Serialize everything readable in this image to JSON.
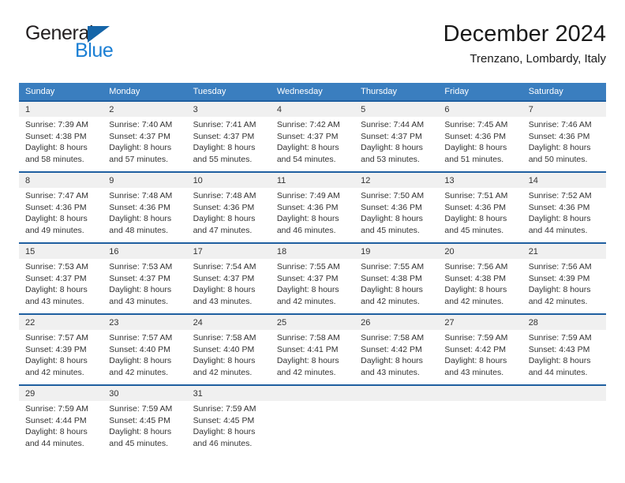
{
  "brand": {
    "name_part1": "General",
    "name_part2": "Blue",
    "triangle_color": "#1565a8",
    "blue_color": "#1b7fd4"
  },
  "header": {
    "title": "December 2024",
    "subtitle": "Trenzano, Lombardy, Italy"
  },
  "theme": {
    "header_row_bg": "#3a7ebf",
    "week_separator": "#1f5fa0",
    "daynum_bg": "#f0f0f0",
    "text": "#333333"
  },
  "calendar": {
    "weekday_headers": [
      "Sunday",
      "Monday",
      "Tuesday",
      "Wednesday",
      "Thursday",
      "Friday",
      "Saturday"
    ],
    "weeks": [
      {
        "days": [
          {
            "num": "1",
            "sunrise": "Sunrise: 7:39 AM",
            "sunset": "Sunset: 4:38 PM",
            "daylight1": "Daylight: 8 hours",
            "daylight2": "and 58 minutes."
          },
          {
            "num": "2",
            "sunrise": "Sunrise: 7:40 AM",
            "sunset": "Sunset: 4:37 PM",
            "daylight1": "Daylight: 8 hours",
            "daylight2": "and 57 minutes."
          },
          {
            "num": "3",
            "sunrise": "Sunrise: 7:41 AM",
            "sunset": "Sunset: 4:37 PM",
            "daylight1": "Daylight: 8 hours",
            "daylight2": "and 55 minutes."
          },
          {
            "num": "4",
            "sunrise": "Sunrise: 7:42 AM",
            "sunset": "Sunset: 4:37 PM",
            "daylight1": "Daylight: 8 hours",
            "daylight2": "and 54 minutes."
          },
          {
            "num": "5",
            "sunrise": "Sunrise: 7:44 AM",
            "sunset": "Sunset: 4:37 PM",
            "daylight1": "Daylight: 8 hours",
            "daylight2": "and 53 minutes."
          },
          {
            "num": "6",
            "sunrise": "Sunrise: 7:45 AM",
            "sunset": "Sunset: 4:36 PM",
            "daylight1": "Daylight: 8 hours",
            "daylight2": "and 51 minutes."
          },
          {
            "num": "7",
            "sunrise": "Sunrise: 7:46 AM",
            "sunset": "Sunset: 4:36 PM",
            "daylight1": "Daylight: 8 hours",
            "daylight2": "and 50 minutes."
          }
        ]
      },
      {
        "days": [
          {
            "num": "8",
            "sunrise": "Sunrise: 7:47 AM",
            "sunset": "Sunset: 4:36 PM",
            "daylight1": "Daylight: 8 hours",
            "daylight2": "and 49 minutes."
          },
          {
            "num": "9",
            "sunrise": "Sunrise: 7:48 AM",
            "sunset": "Sunset: 4:36 PM",
            "daylight1": "Daylight: 8 hours",
            "daylight2": "and 48 minutes."
          },
          {
            "num": "10",
            "sunrise": "Sunrise: 7:48 AM",
            "sunset": "Sunset: 4:36 PM",
            "daylight1": "Daylight: 8 hours",
            "daylight2": "and 47 minutes."
          },
          {
            "num": "11",
            "sunrise": "Sunrise: 7:49 AM",
            "sunset": "Sunset: 4:36 PM",
            "daylight1": "Daylight: 8 hours",
            "daylight2": "and 46 minutes."
          },
          {
            "num": "12",
            "sunrise": "Sunrise: 7:50 AM",
            "sunset": "Sunset: 4:36 PM",
            "daylight1": "Daylight: 8 hours",
            "daylight2": "and 45 minutes."
          },
          {
            "num": "13",
            "sunrise": "Sunrise: 7:51 AM",
            "sunset": "Sunset: 4:36 PM",
            "daylight1": "Daylight: 8 hours",
            "daylight2": "and 45 minutes."
          },
          {
            "num": "14",
            "sunrise": "Sunrise: 7:52 AM",
            "sunset": "Sunset: 4:36 PM",
            "daylight1": "Daylight: 8 hours",
            "daylight2": "and 44 minutes."
          }
        ]
      },
      {
        "days": [
          {
            "num": "15",
            "sunrise": "Sunrise: 7:53 AM",
            "sunset": "Sunset: 4:37 PM",
            "daylight1": "Daylight: 8 hours",
            "daylight2": "and 43 minutes."
          },
          {
            "num": "16",
            "sunrise": "Sunrise: 7:53 AM",
            "sunset": "Sunset: 4:37 PM",
            "daylight1": "Daylight: 8 hours",
            "daylight2": "and 43 minutes."
          },
          {
            "num": "17",
            "sunrise": "Sunrise: 7:54 AM",
            "sunset": "Sunset: 4:37 PM",
            "daylight1": "Daylight: 8 hours",
            "daylight2": "and 43 minutes."
          },
          {
            "num": "18",
            "sunrise": "Sunrise: 7:55 AM",
            "sunset": "Sunset: 4:37 PM",
            "daylight1": "Daylight: 8 hours",
            "daylight2": "and 42 minutes."
          },
          {
            "num": "19",
            "sunrise": "Sunrise: 7:55 AM",
            "sunset": "Sunset: 4:38 PM",
            "daylight1": "Daylight: 8 hours",
            "daylight2": "and 42 minutes."
          },
          {
            "num": "20",
            "sunrise": "Sunrise: 7:56 AM",
            "sunset": "Sunset: 4:38 PM",
            "daylight1": "Daylight: 8 hours",
            "daylight2": "and 42 minutes."
          },
          {
            "num": "21",
            "sunrise": "Sunrise: 7:56 AM",
            "sunset": "Sunset: 4:39 PM",
            "daylight1": "Daylight: 8 hours",
            "daylight2": "and 42 minutes."
          }
        ]
      },
      {
        "days": [
          {
            "num": "22",
            "sunrise": "Sunrise: 7:57 AM",
            "sunset": "Sunset: 4:39 PM",
            "daylight1": "Daylight: 8 hours",
            "daylight2": "and 42 minutes."
          },
          {
            "num": "23",
            "sunrise": "Sunrise: 7:57 AM",
            "sunset": "Sunset: 4:40 PM",
            "daylight1": "Daylight: 8 hours",
            "daylight2": "and 42 minutes."
          },
          {
            "num": "24",
            "sunrise": "Sunrise: 7:58 AM",
            "sunset": "Sunset: 4:40 PM",
            "daylight1": "Daylight: 8 hours",
            "daylight2": "and 42 minutes."
          },
          {
            "num": "25",
            "sunrise": "Sunrise: 7:58 AM",
            "sunset": "Sunset: 4:41 PM",
            "daylight1": "Daylight: 8 hours",
            "daylight2": "and 42 minutes."
          },
          {
            "num": "26",
            "sunrise": "Sunrise: 7:58 AM",
            "sunset": "Sunset: 4:42 PM",
            "daylight1": "Daylight: 8 hours",
            "daylight2": "and 43 minutes."
          },
          {
            "num": "27",
            "sunrise": "Sunrise: 7:59 AM",
            "sunset": "Sunset: 4:42 PM",
            "daylight1": "Daylight: 8 hours",
            "daylight2": "and 43 minutes."
          },
          {
            "num": "28",
            "sunrise": "Sunrise: 7:59 AM",
            "sunset": "Sunset: 4:43 PM",
            "daylight1": "Daylight: 8 hours",
            "daylight2": "and 44 minutes."
          }
        ]
      },
      {
        "days": [
          {
            "num": "29",
            "sunrise": "Sunrise: 7:59 AM",
            "sunset": "Sunset: 4:44 PM",
            "daylight1": "Daylight: 8 hours",
            "daylight2": "and 44 minutes."
          },
          {
            "num": "30",
            "sunrise": "Sunrise: 7:59 AM",
            "sunset": "Sunset: 4:45 PM",
            "daylight1": "Daylight: 8 hours",
            "daylight2": "and 45 minutes."
          },
          {
            "num": "31",
            "sunrise": "Sunrise: 7:59 AM",
            "sunset": "Sunset: 4:45 PM",
            "daylight1": "Daylight: 8 hours",
            "daylight2": "and 46 minutes."
          },
          {
            "num": "",
            "sunrise": "",
            "sunset": "",
            "daylight1": "",
            "daylight2": ""
          },
          {
            "num": "",
            "sunrise": "",
            "sunset": "",
            "daylight1": "",
            "daylight2": ""
          },
          {
            "num": "",
            "sunrise": "",
            "sunset": "",
            "daylight1": "",
            "daylight2": ""
          },
          {
            "num": "",
            "sunrise": "",
            "sunset": "",
            "daylight1": "",
            "daylight2": ""
          }
        ]
      }
    ]
  }
}
